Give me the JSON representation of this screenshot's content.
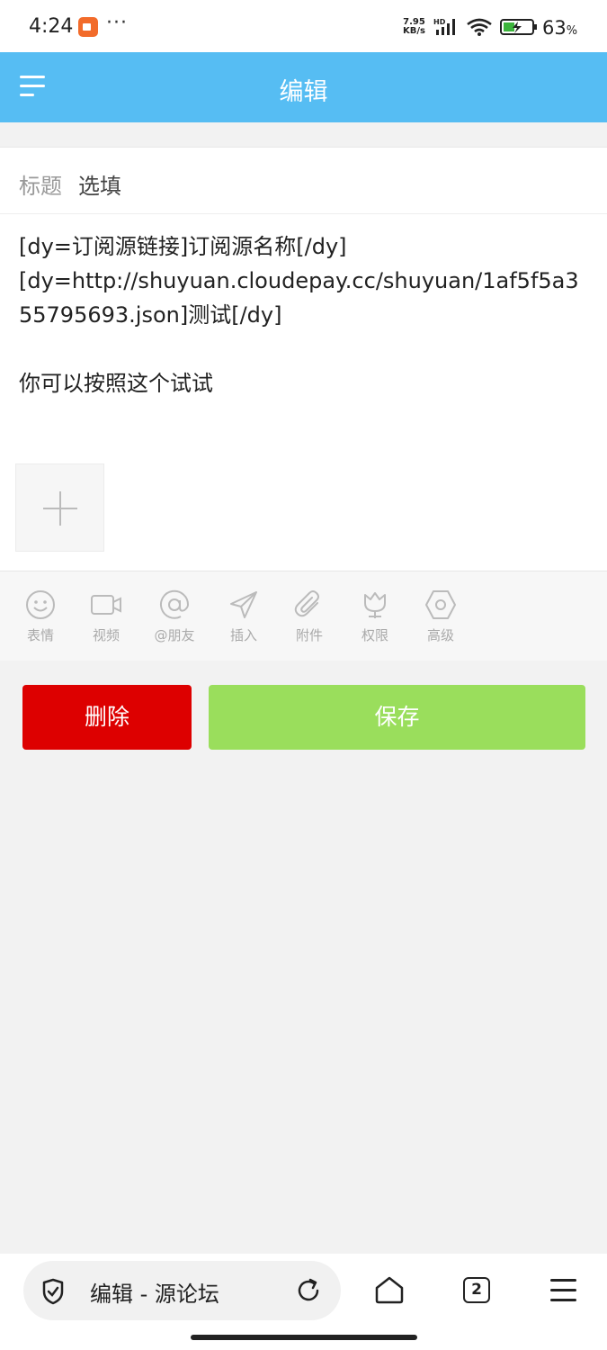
{
  "status_bar": {
    "time": "4:24",
    "more": "···",
    "net_speed_value": "7.95",
    "net_speed_unit": "KB/s",
    "hd": "HD",
    "battery_percent": "63",
    "percent_sign": "%"
  },
  "header": {
    "title": "编辑"
  },
  "title_row": {
    "label": "标题",
    "value": "选填"
  },
  "content": {
    "lines": [
      "[dy=订阅源链接]订阅源名称[/dy]",
      "[dy=http://shuyuan.cloudepay.cc/shuyuan/1af5f5a3",
      "55795693.json]测试[/dy]",
      "",
      "你可以按照这个试试"
    ]
  },
  "toolbar": {
    "items": [
      {
        "label": "表情",
        "icon": "emoji-icon"
      },
      {
        "label": "视频",
        "icon": "video-icon"
      },
      {
        "label": "@朋友",
        "icon": "at-icon"
      },
      {
        "label": "插入",
        "icon": "send-icon"
      },
      {
        "label": "附件",
        "icon": "paperclip-icon"
      },
      {
        "label": "权限",
        "icon": "tulip-icon"
      },
      {
        "label": "高级",
        "icon": "hexagon-icon"
      }
    ]
  },
  "buttons": {
    "delete": "删除",
    "save": "保存"
  },
  "colors": {
    "header_bg": "#56bdf3",
    "delete_bg": "#dd0000",
    "save_bg": "#9ade5c"
  },
  "browser_bar": {
    "address_text": "编辑 - 源论坛",
    "tab_count": "2"
  }
}
